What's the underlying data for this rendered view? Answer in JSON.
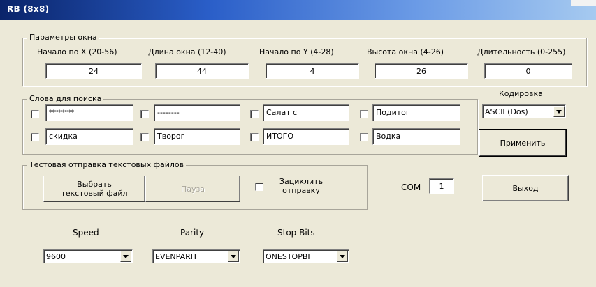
{
  "window": {
    "title": "RB (8x8)"
  },
  "window_params": {
    "legend": "Параметры окна",
    "fields": [
      {
        "label": "Начало по X (20-56)",
        "value": "24"
      },
      {
        "label": "Длина окна (12-40)",
        "value": "44"
      },
      {
        "label": "Начало по Y (4-28)",
        "value": "4"
      },
      {
        "label": "Высота окна (4-26)",
        "value": "26"
      },
      {
        "label": "Длительность (0-255)",
        "value": "0"
      }
    ]
  },
  "search_words": {
    "legend": "Слова для поиска",
    "words": [
      "********",
      "--------",
      "Салат с",
      "Подитог",
      "скидка",
      "Творог",
      "ИТОГО",
      "Водка"
    ]
  },
  "encoding": {
    "label": "Кодировка",
    "value": "ASCII (Dos)"
  },
  "apply_button": "Применить",
  "test_send": {
    "legend": "Тестовая отправка текстовых файлов",
    "choose_button": "Выбрать текстовый файл",
    "pause_button": "Пауза",
    "loop_label": "Зациклить отправку"
  },
  "com": {
    "label": "COM",
    "value": "1"
  },
  "exit_button": "Выход",
  "serial": {
    "speed_label": "Speed",
    "speed_value": "9600",
    "parity_label": "Parity",
    "parity_value": "EVENPARIT",
    "stopbits_label": "Stop Bits",
    "stopbits_value": "ONESTOPBI"
  },
  "icons": {
    "dropdown": "chevron-down-icon"
  }
}
